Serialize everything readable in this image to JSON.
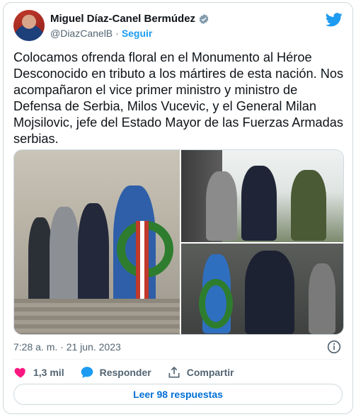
{
  "author": {
    "name": "Miguel Díaz-Canel Bermúdez",
    "handle": "@DiazCanelB",
    "follow_label": "Seguir",
    "separator": "·"
  },
  "tweet": {
    "text": "Colocamos ofrenda floral en el Monumento al Héroe Desconocido en tributo a los mártires de esta nación. Nos acompañaron el vice primer ministro y ministro de Defensa de Serbia, Milos Vucevic, y el General Milan Mojsilovic, jefe del Estado Mayor de las Fuerzas Armadas serbias.",
    "timestamp": "7:28 a. m. · 21 jun. 2023"
  },
  "actions": {
    "likes": "1,3 mil",
    "reply_label": "Responder",
    "share_label": "Compartir"
  },
  "read_replies_label": "Leer 98 respuestas",
  "colors": {
    "accent": "#1d9bf0",
    "like": "#f91880",
    "link": "#006fd6"
  }
}
